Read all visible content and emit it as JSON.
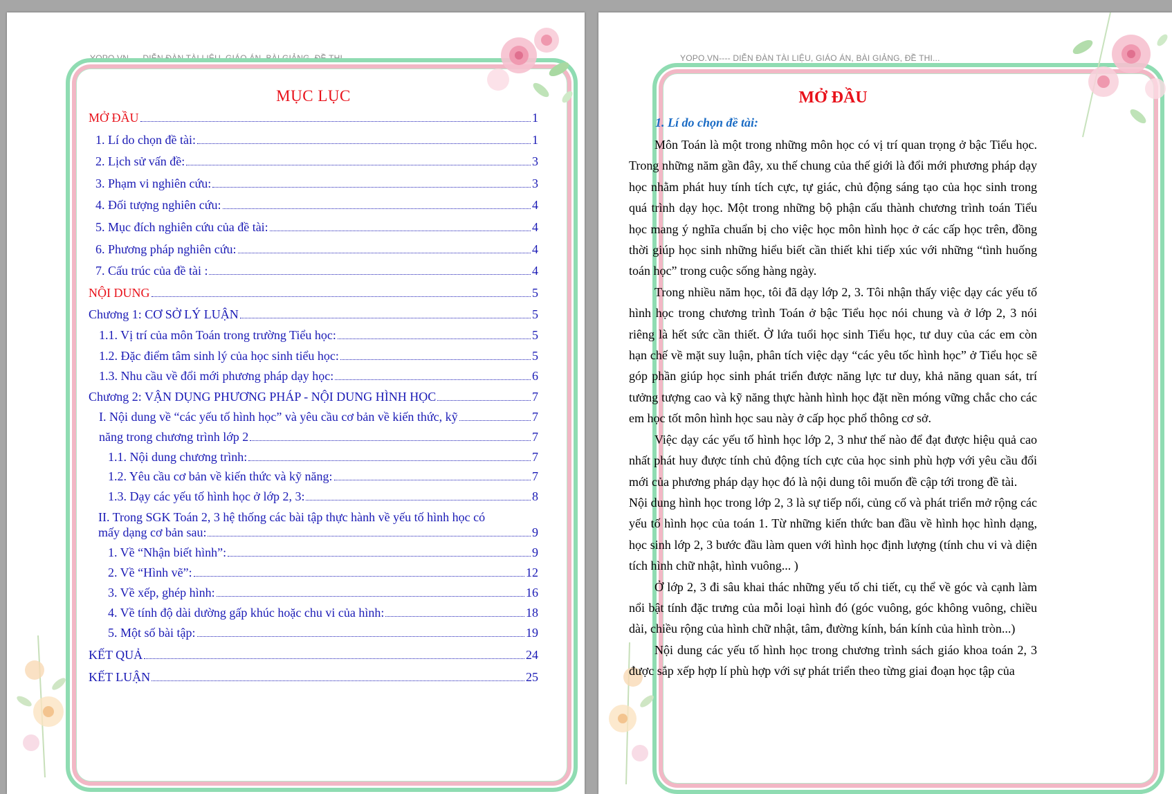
{
  "header_text": "YOPO.VN---- DIỄN ĐÀN TÀI LIỆU, GIÁO ÁN, BÀI GIẢNG, ĐỀ THI...",
  "toc": {
    "title": "MỤC LỤC",
    "entries": [
      {
        "label": "MỞ ĐẦU",
        "page": "1",
        "style": "red",
        "level": 0
      },
      {
        "label": "1.  Lí do chọn đề tài:",
        "page": "1",
        "level": 1
      },
      {
        "label": "2. Lịch sử vấn đề: ",
        "page": "3",
        "level": 1
      },
      {
        "label": "3. Phạm vi nghiên cứu:",
        "page": "3",
        "level": 1
      },
      {
        "label": "4. Đối tượng nghiên cứu:",
        "page": "4",
        "level": 1
      },
      {
        "label": "5. Mục đích nghiên cứu của đề tài:",
        "page": "4",
        "level": 1
      },
      {
        "label": "6. Phương pháp nghiên cứu:",
        "page": "4",
        "level": 1
      },
      {
        "label": "7. Cấu trúc của đề tài : ",
        "page": "4",
        "level": 1
      },
      {
        "label": "NỘI DUNG",
        "page": "5",
        "style": "red",
        "level": 0
      },
      {
        "label": "Chương 1: CƠ SỞ LÝ LUẬN ",
        "page": "5",
        "level": 0
      },
      {
        "label": "1.1. Vị trí của môn Toán trong trường Tiểu học: ",
        "page": "5",
        "level": 2
      },
      {
        "label": "1.2. Đặc điểm tâm sinh lý của học sinh tiểu học: ",
        "page": "5",
        "level": 2
      },
      {
        "label": "1.3. Nhu cầu về đổi mới phương pháp dạy học:",
        "page": "6",
        "level": 2
      },
      {
        "label": "Chương 2: VẬN DỤNG PHƯƠNG PHÁP - NỘI DUNG HÌNH HỌC ",
        "page": "7",
        "level": 0
      },
      {
        "label": "I. Nội dung về “các yếu tố hình học” và yêu cầu cơ bản về kiến thức, kỹ",
        "page": "7",
        "level": 2
      },
      {
        "label": "năng trong chương trình lớp 2",
        "page": "7",
        "level": 2
      },
      {
        "label": "1.1. Nội dung chương trình:",
        "page": "7",
        "level": 3
      },
      {
        "label": "1.2. Yêu cầu cơ bản về kiến thức và kỹ năng:",
        "page": "7",
        "level": 3
      },
      {
        "label": "1.3. Dạy các yếu tố hình học ở lớp 2, 3:",
        "page": "8",
        "level": 3
      }
    ],
    "entry_ii_line1": "II. Trong SGK Toán 2, 3 hệ thống các bài tập thực hành về yếu tố hình học có",
    "entry_ii_line2": "mấy dạng cơ bản sau:",
    "entry_ii_page": "9",
    "entries2": [
      {
        "label": "1. Về “Nhận biết hình”:",
        "page": "9",
        "level": 3
      },
      {
        "label": "2. Về “Hình vẽ”: ",
        "page": "12",
        "level": 3
      },
      {
        "label": "3. Về xếp, ghép hình: ",
        "page": "16",
        "level": 3
      },
      {
        "label": "4. Về tính độ dài dường gấp khúc hoặc chu vi của hình:",
        "page": "18",
        "level": 3
      },
      {
        "label": "5. Một số bài tập: ",
        "page": "19",
        "level": 3
      },
      {
        "label": "KẾT QUẢ ",
        "page": "24",
        "level": 0
      },
      {
        "label": "KẾT LUẬN ",
        "page": "25",
        "level": 0
      }
    ]
  },
  "body": {
    "title": "MỞ ĐẦU",
    "heading": "1.  Lí do chọn đề tài:",
    "paragraphs": [
      {
        "text": "Môn Toán là một trong những môn học có vị trí quan trọng ở bậc Tiểu học. Trong những năm gần đây, xu thế chung của thế giới là đổi mới phương pháp dạy học nhằm phát huy tính tích cực, tự giác, chủ động sáng tạo của học sinh trong quá trình dạy học. Một trong những bộ phận cấu thành chương trình toán Tiểu học mang ý nghĩa chuẩn bị cho việc học môn hình học ở các cấp học trên, đồng thời giúp học sinh những hiểu biết cần thiết khi tiếp xúc với những “tình huống toán học” trong cuộc sống hàng ngày.",
        "indent": true
      },
      {
        "text": "Trong nhiều năm học, tôi đã dạy lớp 2, 3. Tôi nhận thấy việc dạy các yếu tố hình học trong chương trình Toán ở bậc Tiểu học nói chung và ở lớp 2, 3 nói riêng là hết sức cần thiết. Ở lứa tuổi học sinh Tiểu học, tư duy của các em còn hạn chế về mặt suy luận, phân tích việc dạy “các yêu tốc hình học” ở Tiểu học sẽ góp phần giúp học sinh phát triển được năng lực tư duy, khả năng quan sát, trí tưởng tượng cao và kỹ năng thực hành hình học đặt nền móng vững chắc cho các em học tốt môn hình học sau này ở cấp học phổ thông cơ sở.",
        "indent": true
      },
      {
        "text": "Việc dạy các yếu tố hình học lớp 2, 3 như thế nào để đạt được hiệu quả cao nhất phát huy được tính chủ động tích cực của học sinh phù hợp với yêu cầu đổi mới của phương pháp dạy học đó là nội dung tôi muốn đề cập tới trong đề tài.",
        "indent": true
      },
      {
        "text": "Nội dung hình học trong lớp 2, 3 là sự tiếp nối, củng cố và phát triển mở rộng các yếu tố hình học của toán 1. Từ những kiến thức ban đầu về hình học hình dạng, học sinh lớp 2, 3 bước đầu làm quen với hình học định lượng (tính chu vi và diện tích hình chữ nhật, hình vuông... )",
        "indent": false
      },
      {
        "text": " Ở lớp 2, 3 đi sâu khai thác những yếu tố chi tiết, cụ thể về góc và cạnh làm nổi bật tính đặc trưng của mỗi loại hình đó (góc vuông, góc không vuông, chiều dài, chiều rộng của hình chữ nhật, tâm, đường kính, bán kính của hình tròn...)",
        "indent": true
      },
      {
        "text": " Nội dung các yếu tố hình học trong chương trình sách giáo khoa toán 2, 3 được sắp xếp hợp lí phù hợp với sự phát triển theo từng giai đoạn học tập của",
        "indent": true
      }
    ]
  }
}
